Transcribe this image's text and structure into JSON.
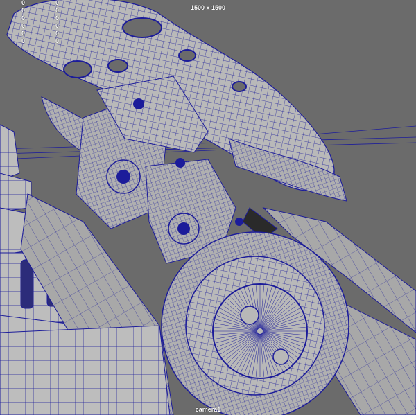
{
  "viewport": {
    "resolution_gate": "1500 x 1500",
    "camera_name": "camera1",
    "wire_color": "#1c1c9a",
    "surface_color": "#b4b4b4",
    "background_color": "#6b6b6b"
  },
  "hud_stats": {
    "rows": [
      {
        "a": "0",
        "b": "0"
      },
      {
        "a": "0",
        "b": "0"
      },
      {
        "a": "0",
        "b": "0"
      },
      {
        "a": "0",
        "b": "0"
      },
      {
        "a": "0",
        "b": "0"
      },
      {
        "a": "0",
        "b": "0"
      }
    ]
  }
}
